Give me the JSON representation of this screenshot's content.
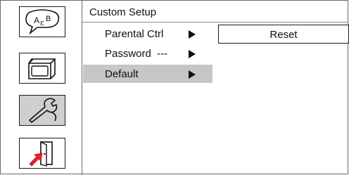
{
  "header": {
    "title": "Custom Setup"
  },
  "sidebar": {
    "buttons": [
      {
        "icon": "language-abc-icon",
        "selected": false
      },
      {
        "icon": "tv-screen-icon",
        "selected": false
      },
      {
        "icon": "wrench-tool-icon",
        "selected": true
      },
      {
        "icon": "exit-door-icon",
        "selected": false
      }
    ]
  },
  "menu": {
    "items": [
      {
        "label": "Parental Ctrl",
        "highlighted": false
      },
      {
        "label": "Password  ---",
        "highlighted": false
      },
      {
        "label": "Default",
        "highlighted": true
      }
    ]
  },
  "submenu": {
    "option_label": "Reset"
  },
  "colors": {
    "highlight": "#c6c6c6",
    "border": "#1a1a1a",
    "accent_red": "#e8202a"
  }
}
